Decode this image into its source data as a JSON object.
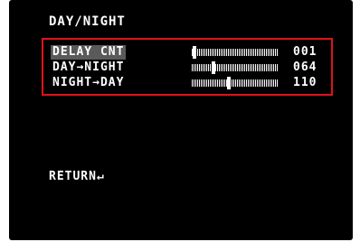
{
  "menu": {
    "title": "DAY/NIGHT",
    "items": [
      {
        "label": "DELAY CNT",
        "value": "001",
        "level": 0.03,
        "selected": true
      },
      {
        "label": "DAY→NIGHT",
        "value": "064",
        "level": 0.25,
        "selected": false
      },
      {
        "label": "NIGHT→DAY",
        "value": "110",
        "level": 0.43,
        "selected": false
      }
    ],
    "return_label": "RETURN↵"
  },
  "colors": {
    "background": "#000000",
    "text": "#ffffff",
    "highlight_border": "#e0121c",
    "selected_bg": "#5a5a5a"
  }
}
